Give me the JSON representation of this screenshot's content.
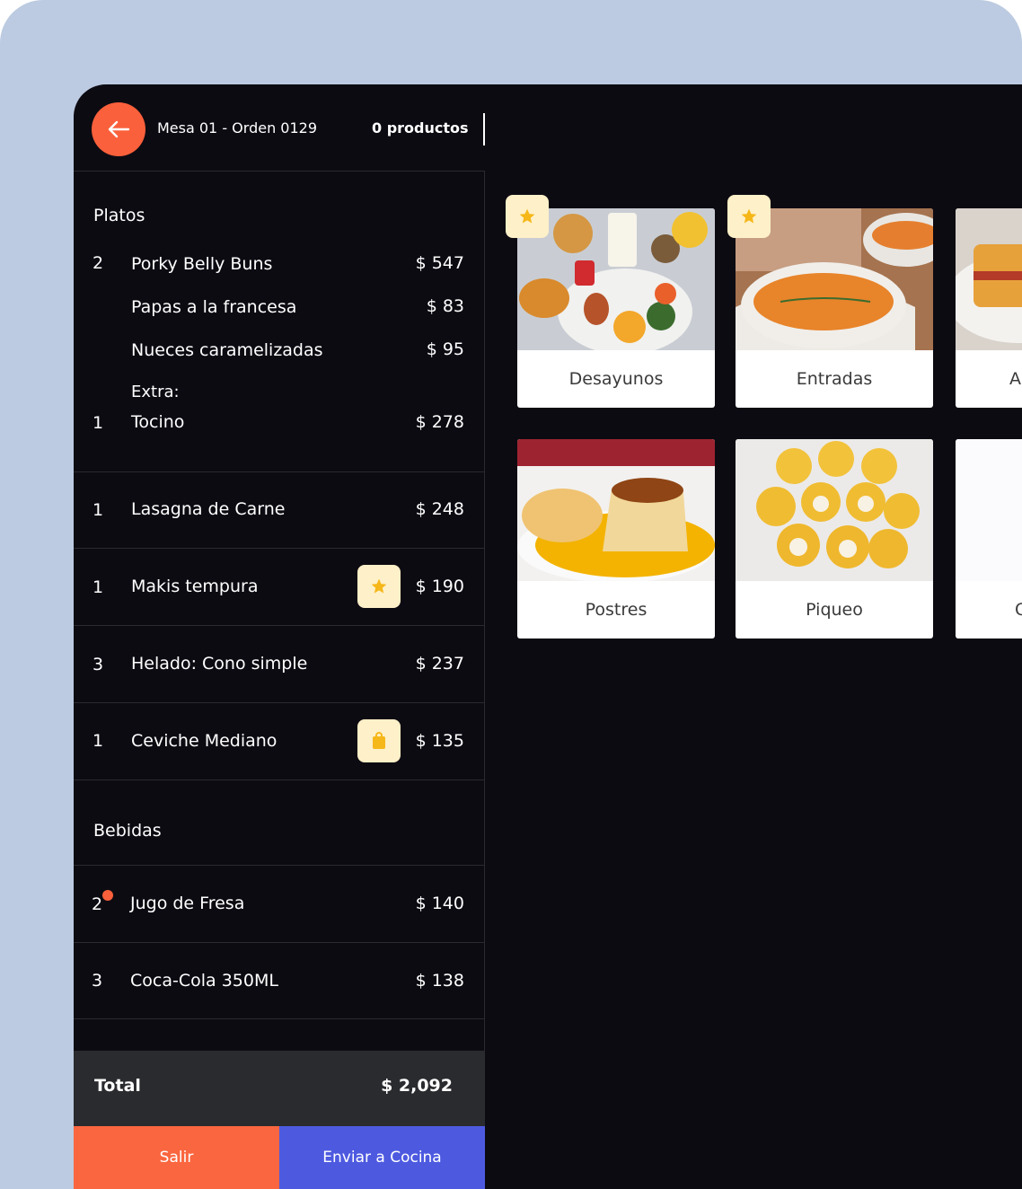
{
  "header": {
    "order_title": "Mesa 01 - Orden 0129",
    "product_count": "0 productos"
  },
  "order": {
    "platos_title": "Platos",
    "items": [
      {
        "qty": "2",
        "name": "Porky Belly Buns",
        "price": "$ 547"
      },
      {
        "qty": "",
        "name": "Papas a la francesa",
        "price": "$ 83"
      },
      {
        "qty": "",
        "name": "Nueces caramelizadas",
        "price": "$ 95"
      },
      {
        "qty": "1",
        "name": "Tocino",
        "price": "$ 278",
        "extra_label": "Extra:"
      },
      {
        "qty": "1",
        "name": "Lasagna de Carne",
        "price": "$ 248"
      },
      {
        "qty": "1",
        "name": "Makis tempura",
        "price": "$ 190",
        "badge_icon": "star-icon"
      },
      {
        "qty": "3",
        "name": "Helado: Cono simple",
        "price": "$ 237"
      },
      {
        "qty": "1",
        "name": "Ceviche Mediano",
        "price": "$ 135",
        "badge_icon": "bag-icon"
      }
    ],
    "bebidas_title": "Bebidas",
    "drinks": [
      {
        "qty": "2",
        "name": "Jugo de Fresa",
        "price": "$ 140"
      },
      {
        "qty": "3",
        "name": "Coca-Cola 350ML",
        "price": "$ 138"
      }
    ],
    "total_label": "Total",
    "total_value": "$ 2,092"
  },
  "actions": {
    "exit_label": "Salir",
    "kitchen_label": "Enviar a Cocina"
  },
  "categories": [
    {
      "label": "Desayunos",
      "favorite": true
    },
    {
      "label": "Entradas",
      "favorite": true
    },
    {
      "label": "Al"
    },
    {
      "label": "Postres"
    },
    {
      "label": "Piqueo"
    },
    {
      "label": "C"
    }
  ],
  "colors": {
    "accent_orange": "#fa603b",
    "accent_blue": "#4d5ae0",
    "badge_bg": "#fef0c8",
    "star_color": "#f6b719",
    "background": "#0d0b12"
  }
}
